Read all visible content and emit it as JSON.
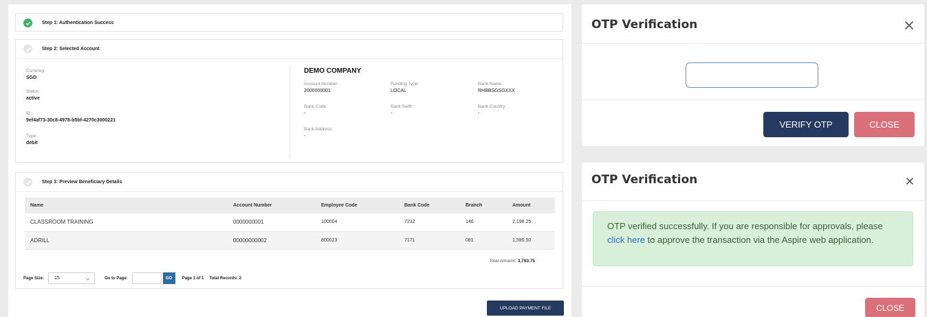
{
  "step1": {
    "title": "Step 1: Authentication Success"
  },
  "step2": {
    "title": "Step 2: Selected Account",
    "left": [
      {
        "label": "Currency:",
        "value": "SGD"
      },
      {
        "label": "Status:",
        "value": "active"
      },
      {
        "label": "ID:",
        "value": "9ef4af73-30c8-4978-b5bf-4270c3000221"
      },
      {
        "label": "Type:",
        "value": "debit"
      }
    ],
    "company": "DEMO COMPANY",
    "account_number_label": "Account Number:",
    "account_number": "2000000001",
    "funding_type_label": "Funding Type:",
    "funding_type": "LOCAL",
    "bank_name_label": "Bank Name:",
    "bank_name": "RHBBSGSGXXX",
    "bank_code_label": "Bank Code:",
    "bank_code": "-",
    "bank_swift_label": "Bank Swift:",
    "bank_swift": "-",
    "bank_country_label": "Bank Country:",
    "bank_country": "-",
    "bank_address_label": "Bank Address:",
    "bank_address": "-"
  },
  "step3": {
    "title": "Step 3: Preview Beneficiary Details",
    "columns": [
      "Name",
      "Account Number",
      "Employee Code",
      "Bank Code",
      "Branch",
      "Amount"
    ],
    "rows": [
      [
        "CLASSROOM TRAINING",
        "0000000001",
        "100004",
        "7232",
        "146",
        "2,198.25"
      ],
      [
        "ADRILL",
        "00000000002",
        "800023",
        "7171",
        "081",
        "1,595.50"
      ]
    ],
    "total_label": "Total Amount:",
    "total_value": "3,793.75",
    "page_size_label": "Page Size:",
    "page_size_value": "15",
    "go_to_page_label": "Go to Page:",
    "go_label": "GO",
    "page_info": "Page 1 of 1",
    "total_records": "Total Records: 2"
  },
  "upload_button": "UPLOAD PAYMENT FILE",
  "modal1": {
    "title": "OTP Verification",
    "otp_value": "",
    "verify_label": "VERIFY OTP",
    "close_label": "CLOSE"
  },
  "modal2": {
    "title": "OTP Verification",
    "message_before": "OTP verified successfully. If you are responsible for approvals, please ",
    "link_text": "click here",
    "message_after": " to approve the transaction via the Aspire web application.",
    "close_label": "CLOSE"
  },
  "colors": {
    "primary": "#263a60",
    "danger": "#d9707a",
    "success_bg": "#d8efd9",
    "success_icon": "#3fb16b",
    "link": "#2c6fd1",
    "go_button": "#2e6da4"
  }
}
